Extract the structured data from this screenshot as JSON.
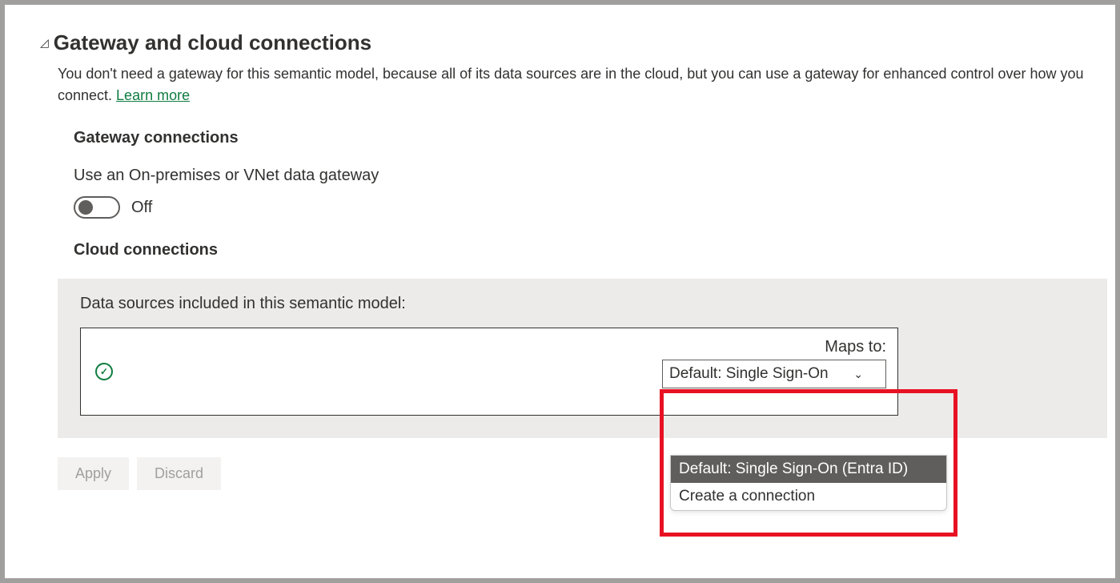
{
  "section": {
    "title": "Gateway and cloud connections",
    "description": "You don't need a gateway for this semantic model, because all of its data sources are in the cloud, but you can use a gateway for enhanced control over how you connect. ",
    "learn_more": "Learn more"
  },
  "gateway": {
    "title": "Gateway connections",
    "toggle_label": "Use an On-premises or VNet data gateway",
    "toggle_state": "Off"
  },
  "cloud": {
    "title": "Cloud connections",
    "panel_label": "Data sources included in this semantic model:",
    "maps_to_label": "Maps to:",
    "dropdown_value": "Default: Single Sign-On",
    "dropdown_options": [
      "Default: Single Sign-On (Entra ID)",
      "Create a connection"
    ]
  },
  "buttons": {
    "apply": "Apply",
    "discard": "Discard"
  }
}
